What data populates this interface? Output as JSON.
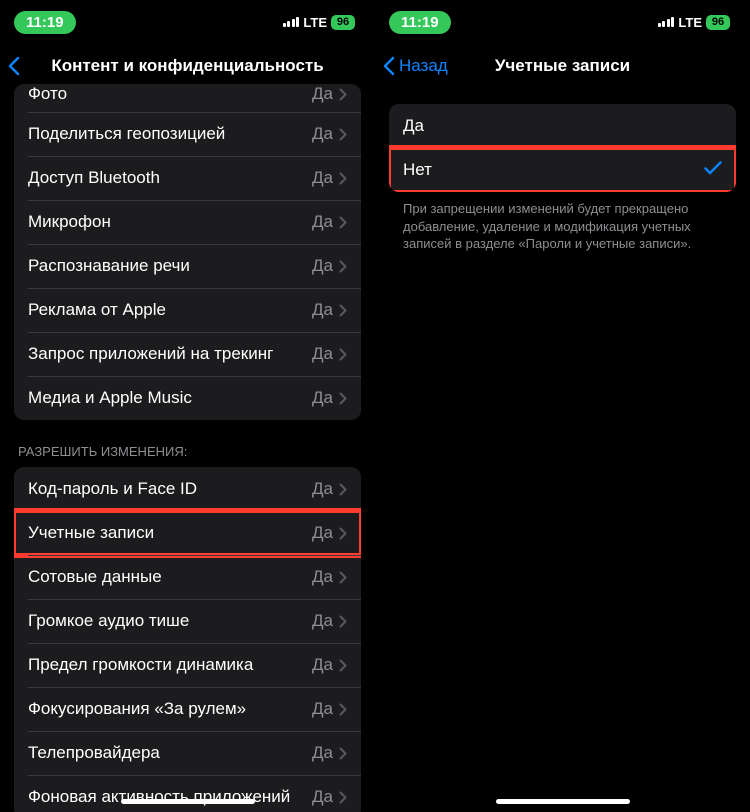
{
  "status": {
    "time": "11:19",
    "lte": "LTE",
    "battery": "96"
  },
  "left": {
    "page_title": "Контент и конфиденциальность",
    "group1": [
      {
        "label": "Фото",
        "value": "Да"
      },
      {
        "label": "Поделиться геопозицией",
        "value": "Да"
      },
      {
        "label": "Доступ Bluetooth",
        "value": "Да"
      },
      {
        "label": "Микрофон",
        "value": "Да"
      },
      {
        "label": "Распознавание речи",
        "value": "Да"
      },
      {
        "label": "Реклама от Apple",
        "value": "Да"
      },
      {
        "label": "Запрос приложений на трекинг",
        "value": "Да"
      },
      {
        "label": "Медиа и Apple Music",
        "value": "Да"
      }
    ],
    "section2_header": "Разрешить изменения:",
    "group2": [
      {
        "label": "Код-пароль и Face ID",
        "value": "Да"
      },
      {
        "label": "Учетные записи",
        "value": "Да",
        "highlight": true
      },
      {
        "label": "Сотовые данные",
        "value": "Да"
      },
      {
        "label": "Громкое аудио тише",
        "value": "Да"
      },
      {
        "label": "Предел громкости динамика",
        "value": "Да"
      },
      {
        "label": "Фокусирования «За рулем»",
        "value": "Да"
      },
      {
        "label": "Телепровайдера",
        "value": "Да"
      },
      {
        "label": "Фоновая активность приложений",
        "value": "Да"
      }
    ]
  },
  "right": {
    "back_label": "Назад",
    "page_title": "Учетные записи",
    "options": [
      {
        "label": "Да",
        "selected": false,
        "highlight": false
      },
      {
        "label": "Нет",
        "selected": true,
        "highlight": true
      }
    ],
    "footer": "При запрещении изменений будет прекращено добавление, удаление и модификация учетных записей в разделе «Пароли и учетные записи»."
  }
}
